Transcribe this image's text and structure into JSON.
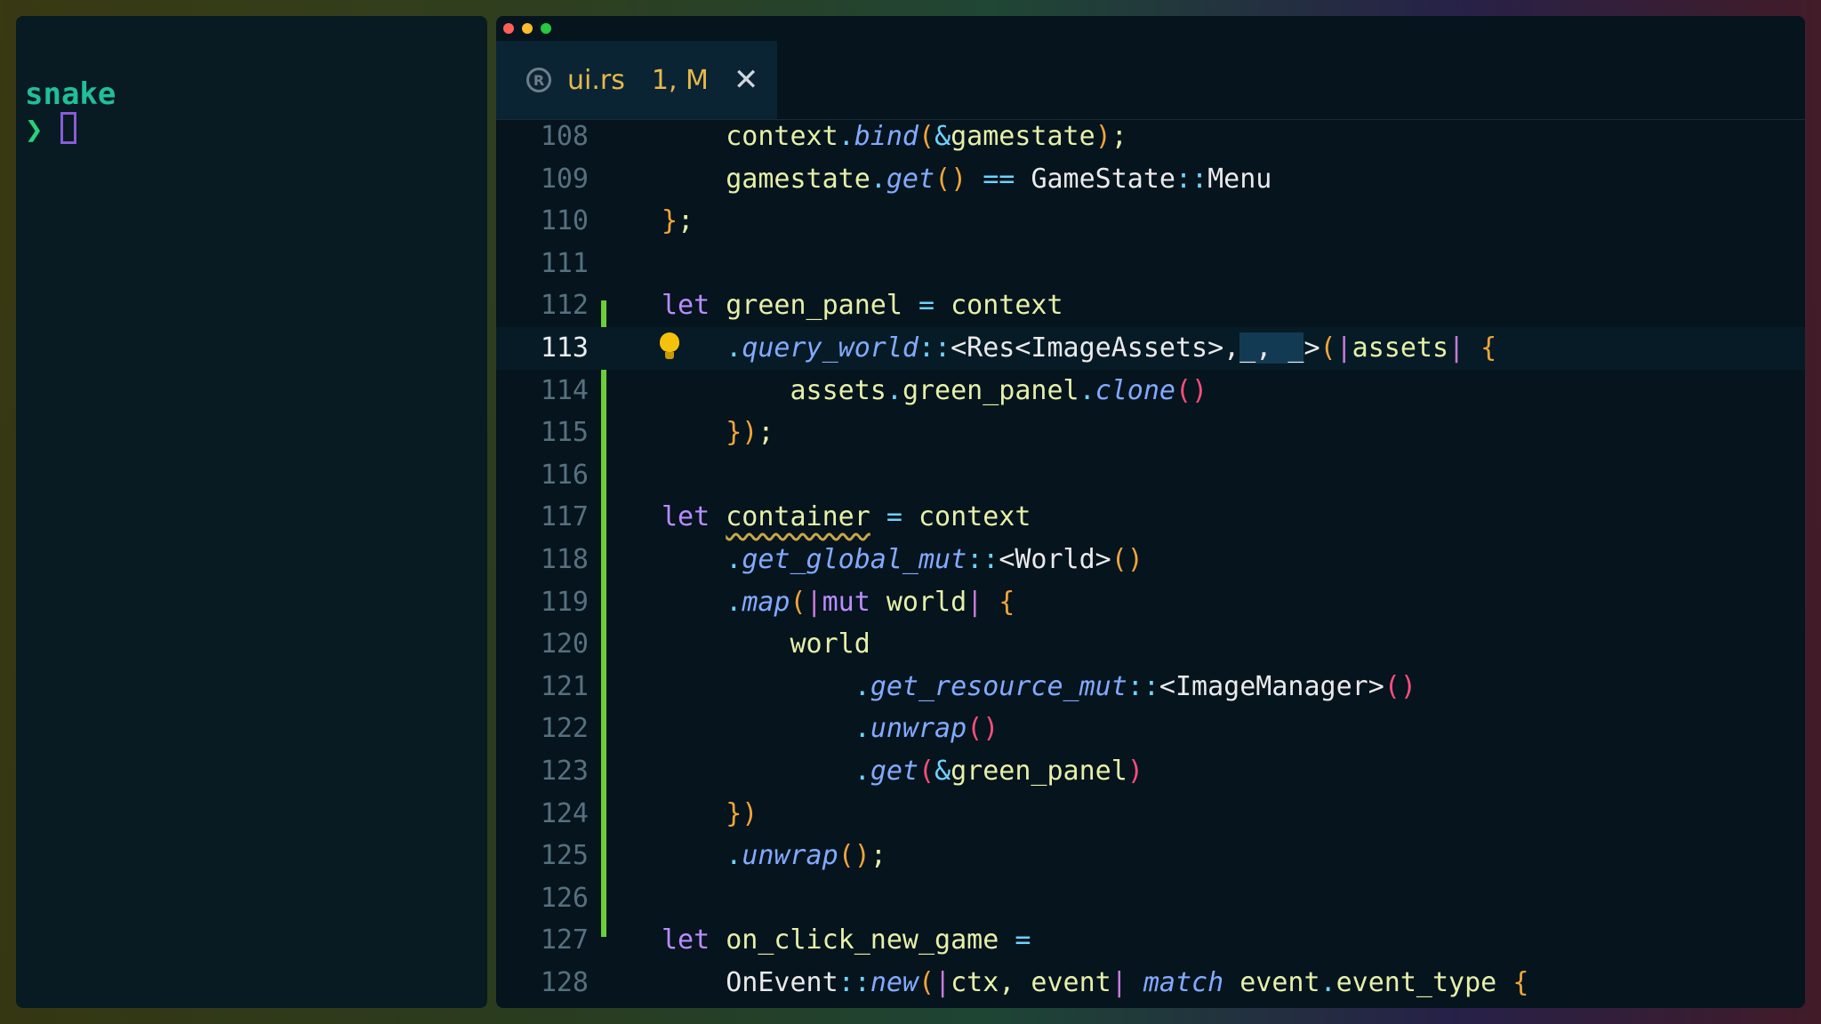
{
  "terminal": {
    "title": "snake",
    "prompt": "❯"
  },
  "tab": {
    "filename": "ui.rs",
    "badge": "1, M",
    "close": "✕",
    "icon": "rust-icon"
  },
  "lines": [
    {
      "n": "108",
      "segments": [
        [
          "var",
          "    context"
        ],
        [
          "op",
          "."
        ],
        [
          "fn",
          "bind"
        ],
        [
          "pa",
          "("
        ],
        [
          "op",
          "&"
        ],
        [
          "var",
          "gamestate"
        ],
        [
          "pa",
          ")"
        ],
        [
          "var",
          ";"
        ]
      ]
    },
    {
      "n": "109",
      "segments": [
        [
          "var",
          "    gamestate"
        ],
        [
          "op",
          "."
        ],
        [
          "fn",
          "get"
        ],
        [
          "pa",
          "()"
        ],
        [
          "op",
          " == "
        ],
        [
          "ty",
          "GameState"
        ],
        [
          "op",
          "::"
        ],
        [
          "ty",
          "Menu"
        ]
      ]
    },
    {
      "n": "110",
      "segments": [
        [
          "pa",
          "}"
        ],
        [
          "var",
          ";"
        ]
      ]
    },
    {
      "n": "111",
      "segments": []
    },
    {
      "n": "112",
      "segments": [
        [
          "kw",
          "let"
        ],
        [
          "var",
          " green_panel "
        ],
        [
          "op",
          "="
        ],
        [
          "var",
          " context"
        ]
      ]
    },
    {
      "n": "113",
      "segments": [
        [
          "op",
          "    ."
        ],
        [
          "fn",
          "query_world"
        ],
        [
          "op",
          "::"
        ],
        [
          "ty",
          "<Res<ImageAssets>,"
        ],
        [
          "ty",
          "_, _"
        ],
        [
          "ty",
          ">"
        ],
        [
          "pa",
          "("
        ],
        [
          "pc",
          "|"
        ],
        [
          "var",
          "assets"
        ],
        [
          "pc",
          "|"
        ],
        [
          "pa",
          " {"
        ]
      ]
    },
    {
      "n": "114",
      "segments": [
        [
          "var",
          "        assets"
        ],
        [
          "op",
          "."
        ],
        [
          "var",
          "green_panel"
        ],
        [
          "op",
          "."
        ],
        [
          "fn",
          "clone"
        ],
        [
          "pb",
          "()"
        ]
      ]
    },
    {
      "n": "115",
      "segments": [
        [
          "pa",
          "    })"
        ],
        [
          "var",
          ";"
        ]
      ]
    },
    {
      "n": "116",
      "segments": []
    },
    {
      "n": "117",
      "segments": [
        [
          "kw",
          "let"
        ],
        [
          "var",
          " "
        ],
        [
          "squig",
          "container"
        ],
        [
          "var",
          " "
        ],
        [
          "op",
          "="
        ],
        [
          "var",
          " context"
        ]
      ]
    },
    {
      "n": "118",
      "segments": [
        [
          "op",
          "    ."
        ],
        [
          "fn",
          "get_global_mut"
        ],
        [
          "op",
          "::"
        ],
        [
          "ty",
          "<World>"
        ],
        [
          "pa",
          "()"
        ]
      ]
    },
    {
      "n": "119",
      "segments": [
        [
          "op",
          "    ."
        ],
        [
          "fn",
          "map"
        ],
        [
          "pa",
          "("
        ],
        [
          "pc",
          "|"
        ],
        [
          "kw",
          "mut"
        ],
        [
          "var",
          " world"
        ],
        [
          "pc",
          "|"
        ],
        [
          "pa",
          " {"
        ]
      ]
    },
    {
      "n": "120",
      "segments": [
        [
          "var",
          "        world"
        ]
      ]
    },
    {
      "n": "121",
      "segments": [
        [
          "op",
          "            ."
        ],
        [
          "fn",
          "get_resource_mut"
        ],
        [
          "op",
          "::"
        ],
        [
          "ty",
          "<ImageManager>"
        ],
        [
          "pb",
          "()"
        ]
      ]
    },
    {
      "n": "122",
      "segments": [
        [
          "op",
          "            ."
        ],
        [
          "fn",
          "unwrap"
        ],
        [
          "pb",
          "()"
        ]
      ]
    },
    {
      "n": "123",
      "segments": [
        [
          "op",
          "            ."
        ],
        [
          "fn",
          "get"
        ],
        [
          "pb",
          "("
        ],
        [
          "op",
          "&"
        ],
        [
          "var",
          "green_panel"
        ],
        [
          "pb",
          ")"
        ]
      ]
    },
    {
      "n": "124",
      "segments": [
        [
          "pa",
          "    })"
        ]
      ]
    },
    {
      "n": "125",
      "segments": [
        [
          "op",
          "    ."
        ],
        [
          "fn",
          "unwrap"
        ],
        [
          "pa",
          "()"
        ],
        [
          "var",
          ";"
        ]
      ]
    },
    {
      "n": "126",
      "segments": []
    },
    {
      "n": "127",
      "segments": [
        [
          "kw",
          "let"
        ],
        [
          "var",
          " on_click_new_game "
        ],
        [
          "op",
          "="
        ]
      ]
    },
    {
      "n": "128",
      "segments": [
        [
          "ty",
          "    OnEvent"
        ],
        [
          "op",
          "::"
        ],
        [
          "fn",
          "new"
        ],
        [
          "pa",
          "("
        ],
        [
          "pc",
          "|"
        ],
        [
          "var",
          "ctx, event"
        ],
        [
          "pc",
          "|"
        ],
        [
          "var",
          " "
        ],
        [
          "fn",
          "match"
        ],
        [
          "var",
          " event"
        ],
        [
          "op",
          "."
        ],
        [
          "var",
          "event_type "
        ],
        [
          "pa",
          "{"
        ]
      ]
    }
  ],
  "active_line": "113"
}
